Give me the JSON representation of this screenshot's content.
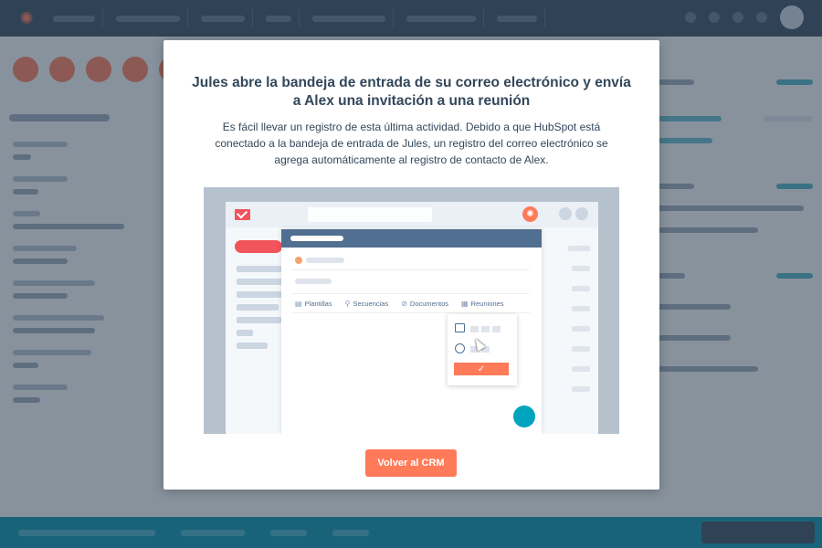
{
  "modal": {
    "title": "Jules abre la bandeja de entrada de su correo electrónico y envía a Alex una invitación a una reunión",
    "body": "Es fácil llevar un registro de esta última actividad. Debido a que HubSpot está conectado a la bandeja de entrada de Jules, un registro del correo electrónico se agrega automáticamente al registro de contacto de Alex.",
    "button_label": "Volver al CRM"
  },
  "illustration": {
    "toolbar": {
      "templates": "Plantillas",
      "sequences": "Secuencias",
      "documents": "Documentos",
      "meetings": "Reuniones"
    },
    "confirm_glyph": "✓"
  },
  "colors": {
    "accent": "#ff7a59",
    "nav": "#33475b",
    "compose_header": "#516f90",
    "chat": "#00a4bd",
    "mail_red": "#f2545b"
  }
}
